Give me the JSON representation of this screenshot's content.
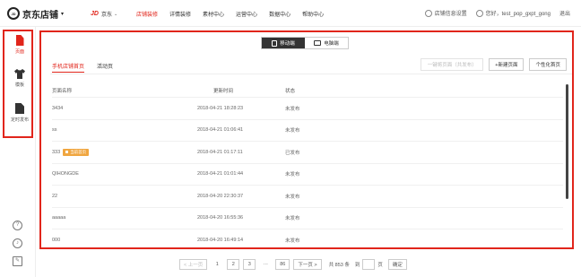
{
  "header": {
    "logo_badge": "JD",
    "logo_text": "京东店铺",
    "jd_mark": "JD",
    "jd_label": "京东",
    "nav": [
      "店铺装修",
      "详情装修",
      "素材中心",
      "运营中心",
      "数据中心",
      "帮助中心"
    ],
    "shop_settings": "店铺信息设置",
    "greeting": "您好，test_pop_gxpt_gong",
    "logout": "退出"
  },
  "sidebar": {
    "items": [
      {
        "label": "页面",
        "icon": "page-icon",
        "active": true
      },
      {
        "label": "模板",
        "icon": "shirt-icon",
        "active": false
      },
      {
        "label": "定时发布",
        "icon": "timer-icon",
        "active": false
      }
    ],
    "bottom_icons": [
      "help-icon",
      "support-icon",
      "edit-icon"
    ]
  },
  "main": {
    "device_toggle": {
      "mobile": "移动端",
      "pc": "电脑端"
    },
    "tabs": [
      "手机店铺首页",
      "活动页"
    ],
    "actions": {
      "batch": "一键将页面（共发布）",
      "new_page": "+新建页面",
      "personalize": "个性化首页"
    },
    "columns": [
      "页面名称",
      "更新时间",
      "状态"
    ],
    "rows": [
      {
        "name": "3434",
        "badge": "",
        "time": "2018-04-21 18:28:23",
        "status": "未发布"
      },
      {
        "name": "ss",
        "badge": "",
        "time": "2018-04-21 01:06:41",
        "status": "未发布"
      },
      {
        "name": "333",
        "badge": "当前首页",
        "time": "2018-04-21 01:17:11",
        "status": "已发布"
      },
      {
        "name": "QIHONGDE",
        "badge": "",
        "time": "2018-04-21 01:01:44",
        "status": "未发布"
      },
      {
        "name": "22",
        "badge": "",
        "time": "2018-04-20 22:30:37",
        "status": "未发布"
      },
      {
        "name": "aaaaa",
        "badge": "",
        "time": "2018-04-20 16:55:36",
        "status": "未发布"
      },
      {
        "name": "000",
        "badge": "",
        "time": "2018-04-20 16:49:14",
        "status": "未发布"
      }
    ]
  },
  "pagination": {
    "prev": "< 上一页",
    "pages": [
      "1",
      "2",
      "3",
      "···",
      "86"
    ],
    "next": "下一页 >",
    "total": "共 853 条",
    "goto": "到",
    "page_unit": "页",
    "confirm": "确定"
  },
  "colors": {
    "accent": "#e1251b",
    "badge": "#f0a640"
  }
}
